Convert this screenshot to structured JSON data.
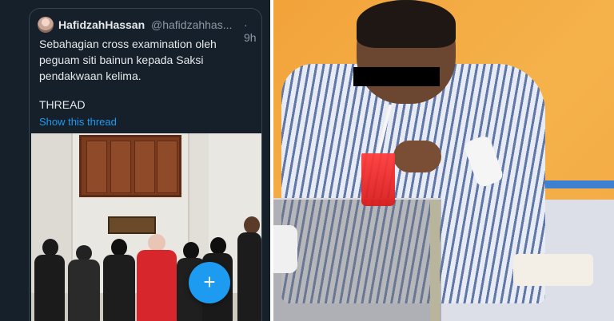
{
  "tweet": {
    "display_name": "HafidzahHassan",
    "handle": "@hafidzahhas...",
    "time": "· 9h",
    "text_line1": "Sebahagian cross examination oleh",
    "text_line2": "peguam siti bainun kepada Saksi",
    "text_line3": "pendakwaan kelima.",
    "thread_label": "THREAD",
    "show_thread": "Show this thread"
  },
  "fab": {
    "icon": "compose-icon",
    "glyph": "+"
  },
  "colors": {
    "tweet_bg": "#15202b",
    "link": "#1d9bf0",
    "text": "#e7e9ea",
    "muted": "#8b98a5",
    "photo_bg": "#f5b24b"
  }
}
